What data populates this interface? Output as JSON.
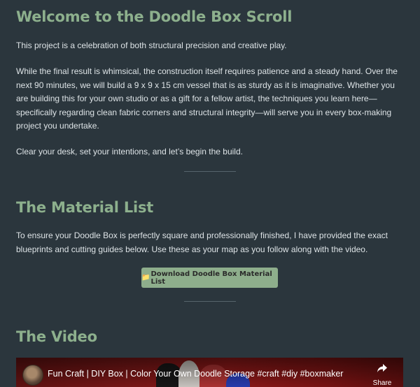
{
  "intro": {
    "title": "Welcome to the Doodle Box Scroll",
    "para1": "This project is a celebration of both structural precision and creative play.",
    "para2": "While the final result is whimsical, the construction itself requires patience and a steady hand. Over the next 90 minutes, we will build a 9 x 9 x 15 cm vessel that is as sturdy as it is imaginative. Whether you are building this for your own studio or as a gift for a fellow artist, the techniques you learn here—specifically regarding clean fabric corners and structural integrity—will serve you in every box-making project you undertake.",
    "para3": "Clear your desk, set your intentions, and let’s begin the build."
  },
  "materials": {
    "title": "The Material List",
    "para": "To ensure your Doodle Box is perfectly square and professionally finished, I have provided the exact blueprints and cutting guides below. Use these as your map as you follow along with the video.",
    "button_icon": "📁",
    "button_label": "Download Doodle Box Material List"
  },
  "video_section": {
    "title": "The Video",
    "video_title": "Fun Craft | DIY Box | Color Your Own Doodle Storage #craft #diy #boxmaker",
    "share_label": "Share",
    "share_icon": "share-arrow-icon"
  },
  "colors": {
    "background": "#2b363d",
    "heading": "#8db08d",
    "button": "#8eae8c",
    "text": "#dde3e6"
  }
}
